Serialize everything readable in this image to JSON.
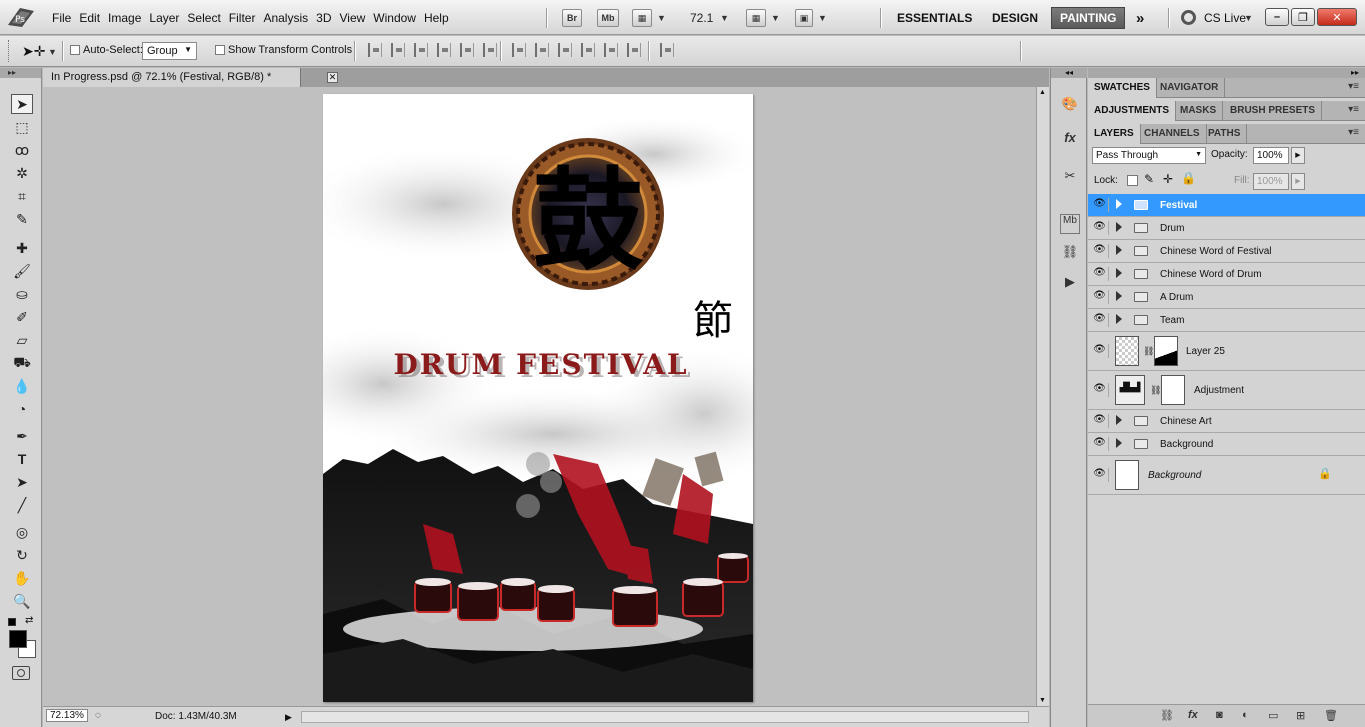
{
  "app": {
    "logo": "Ps"
  },
  "menu": [
    "File",
    "Edit",
    "Image",
    "Layer",
    "Select",
    "Filter",
    "Analysis",
    "3D",
    "View",
    "Window",
    "Help"
  ],
  "appbar": {
    "bridge": "Br",
    "minibridge": "Mb",
    "zoom": "72.1"
  },
  "workspaces": {
    "essentials": "ESSENTIALS",
    "design": "DESIGN",
    "painting": "PAINTING",
    "more": "»",
    "cslive": "CS Live"
  },
  "options": {
    "auto_select_label": "Auto-Select:",
    "auto_select_value": "Group",
    "transform_label": "Show Transform Controls"
  },
  "document": {
    "tab_title": "In Progress.psd @ 72.1% (Festival, RGB/8) *",
    "artwork_title": "DRUM FESTIVAL",
    "artwork_char_big": "鼓",
    "artwork_char_small": "節"
  },
  "status": {
    "zoom": "72.13%",
    "doc": "Doc: 1.43M/40.3M"
  },
  "panels": {
    "row1": [
      "SWATCHES",
      "NAVIGATOR"
    ],
    "row2": [
      "ADJUSTMENTS",
      "MASKS",
      "BRUSH PRESETS"
    ],
    "row3": [
      "LAYERS",
      "CHANNELS",
      "PATHS"
    ],
    "blend_mode": "Pass Through",
    "opacity_label": "Opacity:",
    "opacity": "100%",
    "lock_label": "Lock:",
    "fill_label": "Fill:",
    "fill": "100%"
  },
  "layers": [
    {
      "name": "Festival",
      "type": "group",
      "selected": true
    },
    {
      "name": "Drum",
      "type": "group"
    },
    {
      "name": "Chinese Word of Festival",
      "type": "group"
    },
    {
      "name": "Chinese Word of Drum",
      "type": "group"
    },
    {
      "name": "A Drum",
      "type": "group"
    },
    {
      "name": "Team",
      "type": "group"
    },
    {
      "name": "Layer 25",
      "type": "masked"
    },
    {
      "name": "Adjustment",
      "type": "adjustment"
    },
    {
      "name": "Chinese Art",
      "type": "group"
    },
    {
      "name": "Background",
      "type": "group"
    },
    {
      "name": "Background",
      "type": "background"
    }
  ],
  "colors": {
    "selection": "#3399ff",
    "accent_red": "#8b1a1a",
    "close": "#c42b1c"
  }
}
